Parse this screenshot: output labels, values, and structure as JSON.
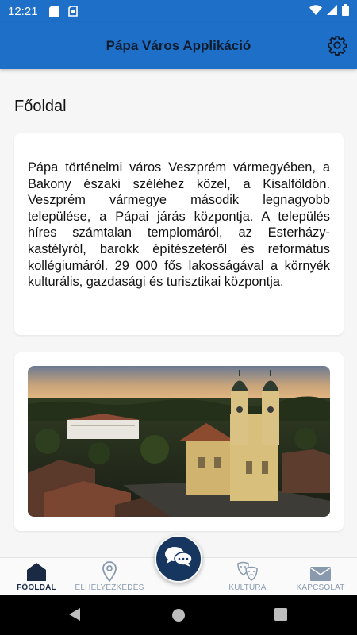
{
  "status_bar": {
    "time": "12:21",
    "icons": [
      "sd-card-icon",
      "sim-icon",
      "wifi-icon",
      "signal-icon",
      "battery-icon"
    ]
  },
  "app_bar": {
    "title": "Pápa Város Applikáció",
    "settings_icon": "gear-icon",
    "color": "#1e6fc8"
  },
  "page": {
    "title": "Főoldal",
    "intro": "Pápa történelmi város Veszprém vármegyében, a Bakony északi széléhez közel, a Kisalföldön. Veszprém vármegye második legnagyobb települése, a Pápai járás központja. A település híres számtalan templomáról, az Esterházy-kastélyról, barokk építészetéről és református kollégiumáról. 29 000 fős lakosságával a környék kulturális, gazdasági és turisztikai központja."
  },
  "bottom_nav": {
    "items": [
      {
        "label": "FŐOLDAL",
        "icon": "home-icon",
        "active": true
      },
      {
        "label": "ELHELYEZKEDÉS",
        "icon": "location-pin-icon",
        "active": false
      },
      {
        "label": "KULTÚRA",
        "icon": "theater-masks-icon",
        "active": false
      },
      {
        "label": "KAPCSOLAT",
        "icon": "envelope-icon",
        "active": false
      }
    ],
    "center_button_icon": "chat-bubbles-icon",
    "active_color": "#1b2a44",
    "inactive_color": "#8a9aae",
    "center_color": "#163660"
  },
  "system_nav": {
    "icons": [
      "back-icon",
      "home-circle-icon",
      "recents-icon"
    ]
  }
}
